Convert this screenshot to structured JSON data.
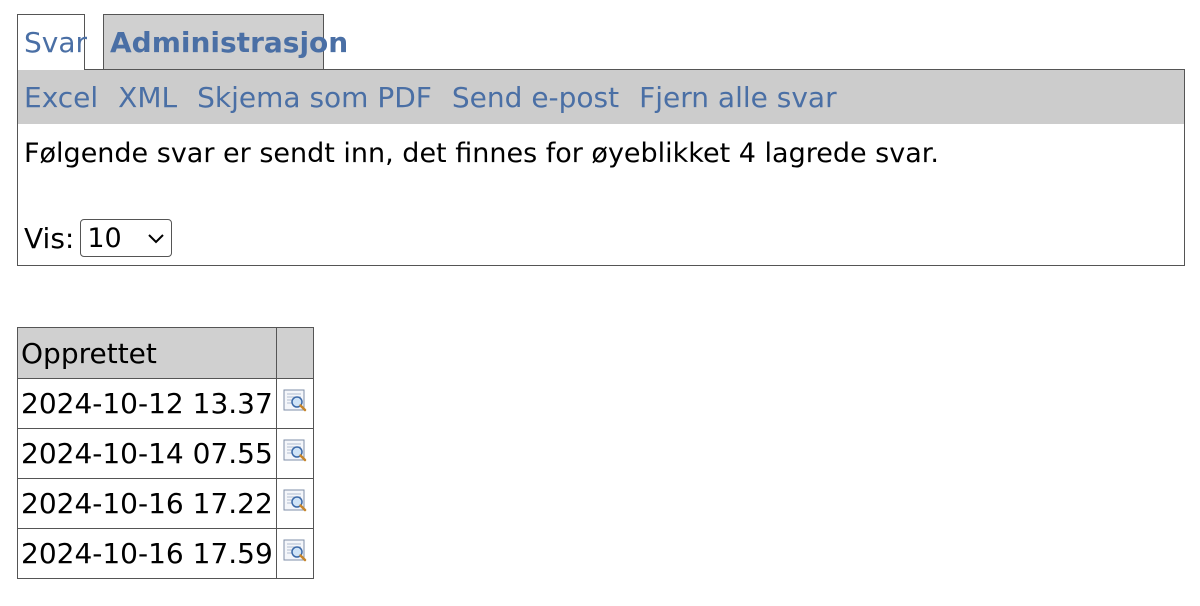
{
  "tabs": [
    {
      "label": "Svar",
      "active": true
    },
    {
      "label": "Administrasjon",
      "active": false
    }
  ],
  "toolbar": {
    "links": [
      "Excel",
      "XML",
      "Skjema som PDF",
      "Send e-post",
      "Fjern alle svar"
    ]
  },
  "info_text": "Følgende svar er sendt inn, det finnes for øyeblikket 4 lagrede svar.",
  "vis": {
    "label": "Vis:",
    "selected": "10"
  },
  "table": {
    "headers": [
      "Opprettet",
      ""
    ],
    "rows": [
      {
        "created": "2024-10-12 13.37",
        "action_icon": "view-details-icon"
      },
      {
        "created": "2024-10-14 07.55",
        "action_icon": "view-details-icon"
      },
      {
        "created": "2024-10-16 17.22",
        "action_icon": "view-details-icon"
      },
      {
        "created": "2024-10-16 17.59",
        "action_icon": "view-details-icon"
      }
    ]
  },
  "colors": {
    "link": "#4a6fa5",
    "toolbar_bg": "#cccccc",
    "header_bg": "#d0d0d0",
    "border": "#555555"
  }
}
